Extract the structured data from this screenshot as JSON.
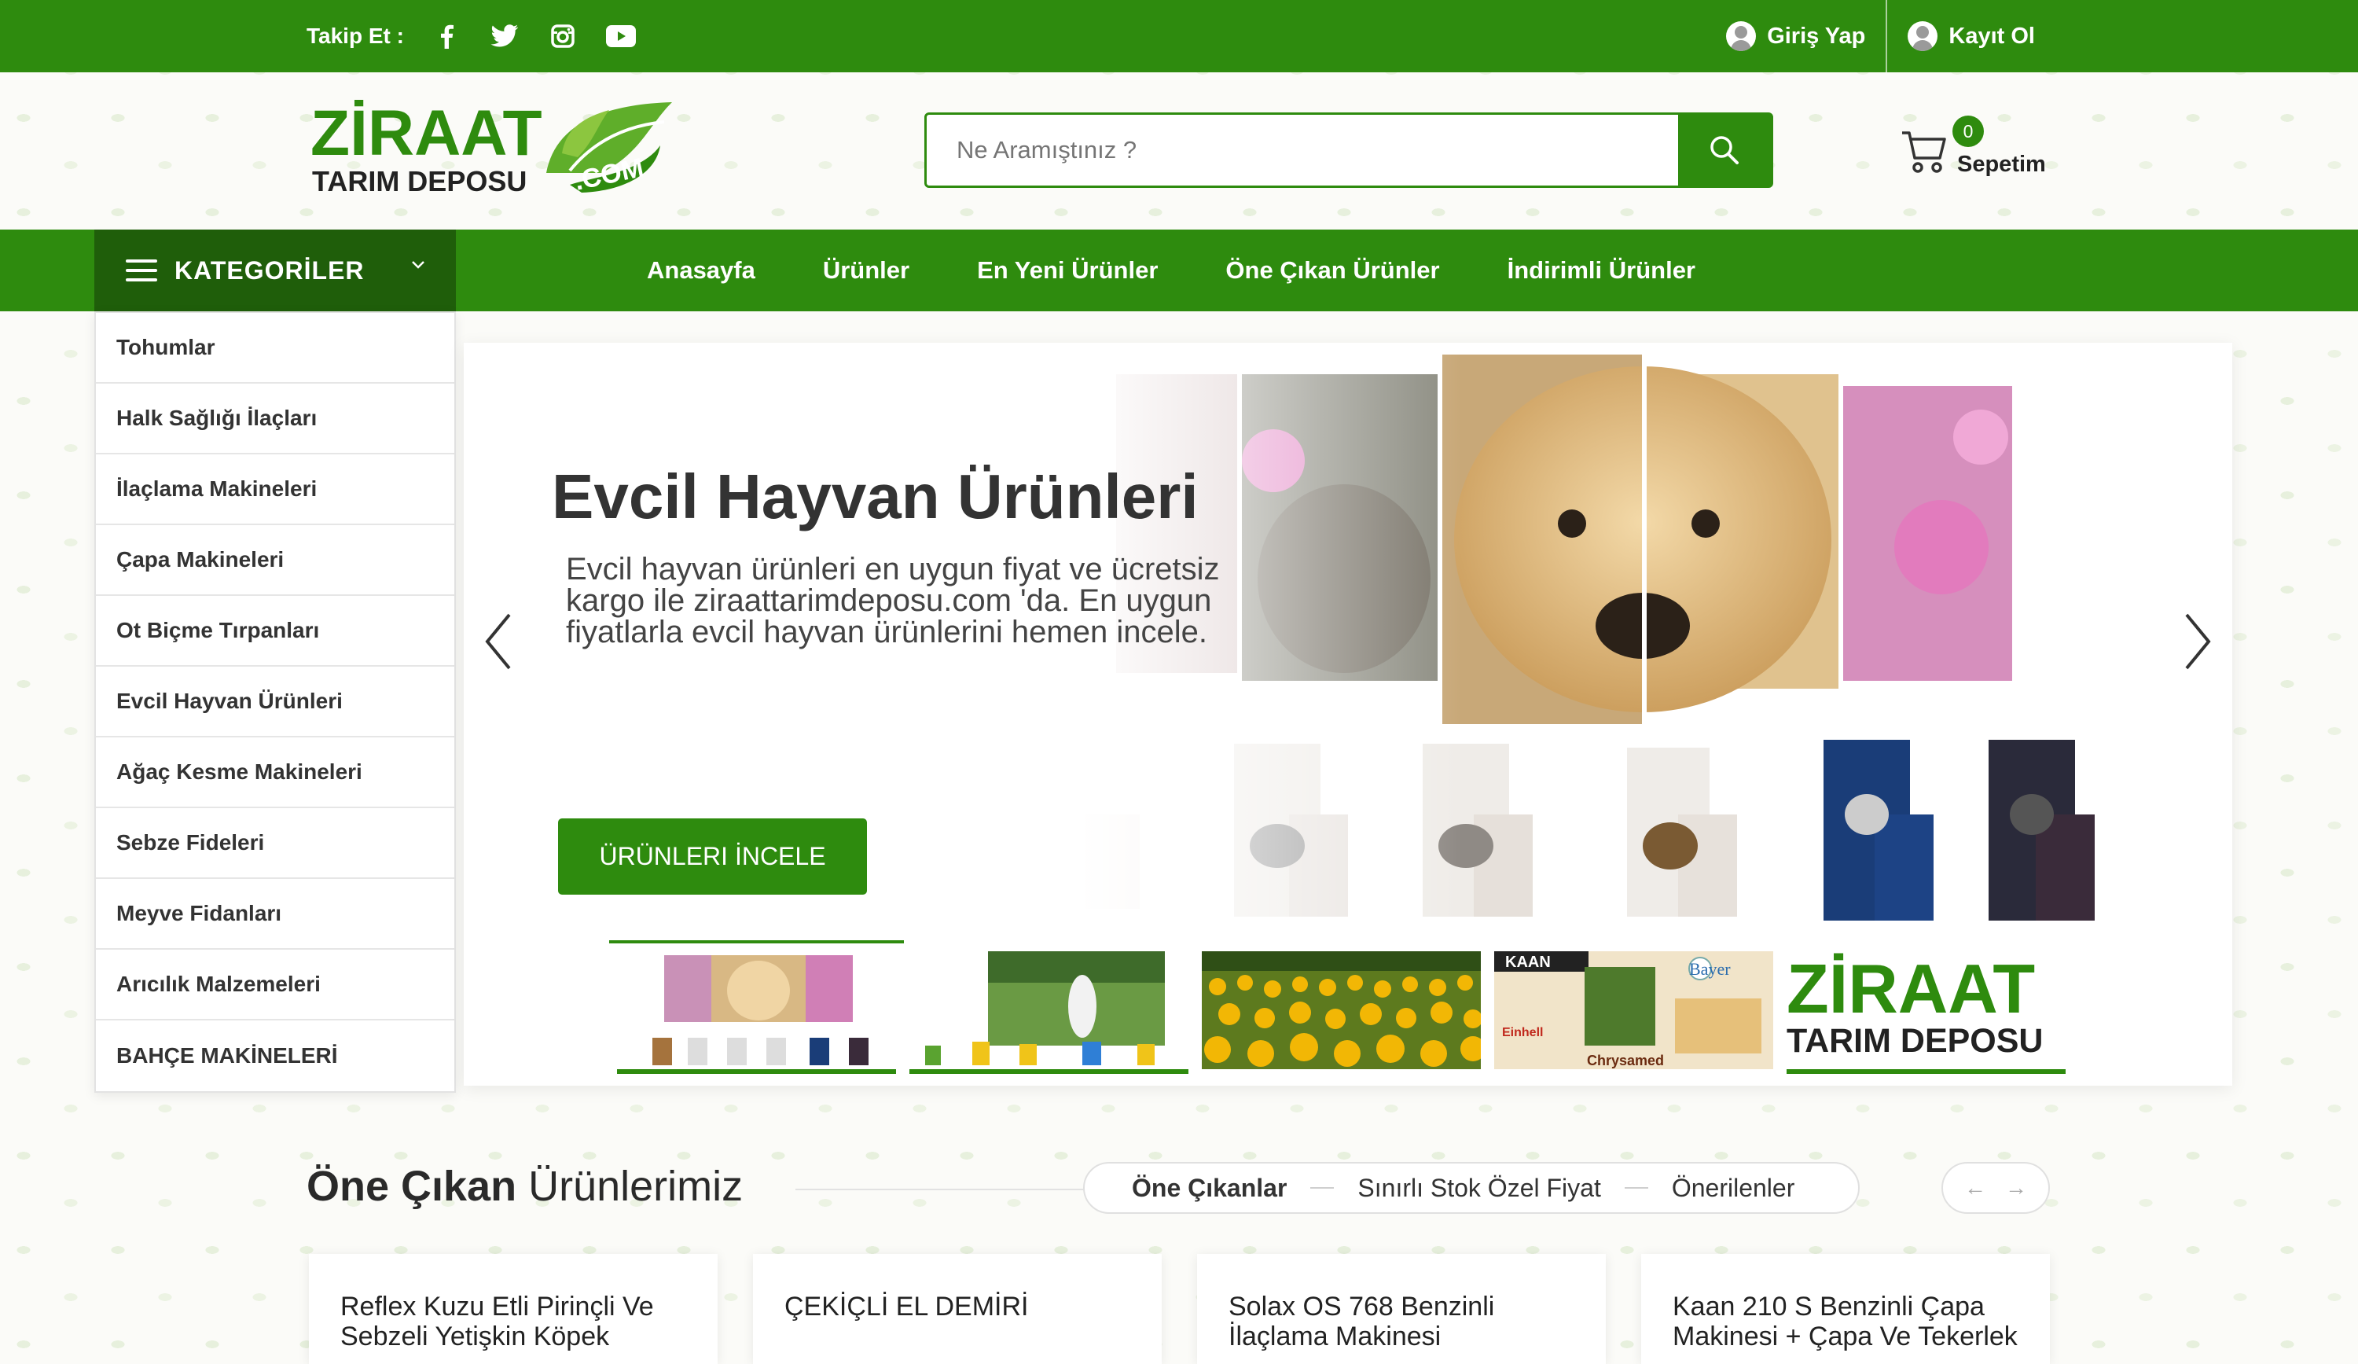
{
  "topbar": {
    "follow_label": "Takip Et :",
    "social_icons": [
      "facebook-icon",
      "twitter-icon",
      "instagram-icon",
      "youtube-icon"
    ],
    "login": "Giriş Yap",
    "register": "Kayıt Ol"
  },
  "logo": {
    "line1": "ZİRAAT",
    "line2": "TARIM DEPOSU",
    "com": ".COM"
  },
  "search": {
    "placeholder": "Ne Aramıştınız ?"
  },
  "cart": {
    "count": "0",
    "label": "Sepetim"
  },
  "nav": {
    "categories_label": "KATEGORİLER",
    "links": [
      "Anasayfa",
      "Ürünler",
      "En Yeni Ürünler",
      "Öne Çıkan Ürünler",
      "İndirimli Ürünler"
    ]
  },
  "categories": [
    "Tohumlar",
    "Halk Sağlığı İlaçları",
    "İlaçlama Makineleri",
    "Çapa Makineleri",
    "Ot Biçme Tırpanları",
    "Evcil Hayvan Ürünleri",
    "Ağaç Kesme Makineleri",
    "Sebze Fideleri",
    "Meyve Fidanları",
    "Arıcılık Malzemeleri",
    "BAHÇE MAKİNELERİ"
  ],
  "slider": {
    "title": "Evcil Hayvan Ürünleri",
    "description": "Evcil hayvan ürünleri en uygun fiyat ve ücretsiz kargo ile ziraattarimdeposu.com 'da. En uygun fiyatlarla evcil hayvan ürünlerini hemen incele.",
    "button": "ÜRÜNLERI İNCELE",
    "thumb_text": {
      "kaan": "KAAN",
      "bayer": "Bayer",
      "chrysamed": "Chrysamed",
      "einhell": "Einhell",
      "brand1": "ZİRAAT",
      "brand2": "TARIM DEPOSU"
    }
  },
  "section": {
    "title_bold": "Öne Çıkan",
    "title_rest": " Ürünlerimiz",
    "tabs": [
      "Öne Çıkanlar",
      "Sınırlı Stok Özel Fiyat",
      "Önerilenler"
    ],
    "prev": "←",
    "next": "→"
  },
  "products": [
    "Reflex Kuzu Etli Pirinçli Ve Sebzeli Yetişkin Köpek",
    "ÇEKİÇLİ EL DEMİRİ",
    "Solax OS 768 Benzinli İlaçlama Makinesi",
    "Kaan 210 S Benzinli Çapa Makinesi + Çapa Ve Tekerlek"
  ],
  "colors": {
    "brand_green": "#2e8b0e",
    "dark_green": "#1f5e0a"
  }
}
